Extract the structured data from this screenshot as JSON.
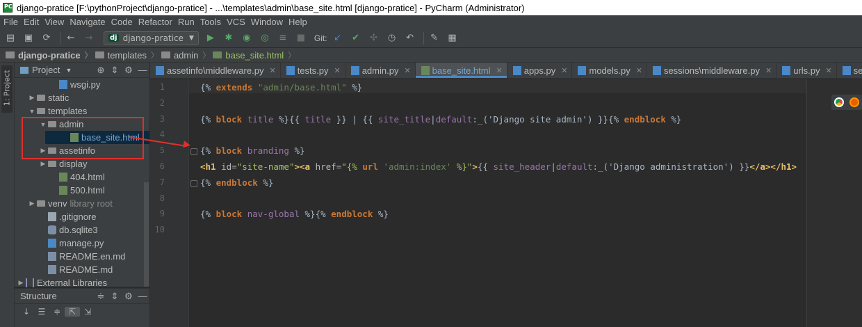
{
  "window": {
    "title": "django-pratice [F:\\pythonProject\\django-pratice] - ...\\templates\\admin\\base_site.html [django-pratice] - PyCharm (Administrator)"
  },
  "menu": [
    "File",
    "Edit",
    "View",
    "Navigate",
    "Code",
    "Refactor",
    "Run",
    "Tools",
    "VCS",
    "Window",
    "Help"
  ],
  "toolbar": {
    "run_config": "django-pratice",
    "run_config_badge": "dj",
    "git_label": "Git:"
  },
  "breadcrumbs": [
    "django-pratice",
    "templates",
    "admin",
    "base_site.html"
  ],
  "left_strip": {
    "project_tab": "1: Project"
  },
  "project_panel": {
    "title": "Project",
    "tree": [
      {
        "label": "wsgi.py",
        "kind": "py",
        "indent": 3,
        "arrow": ""
      },
      {
        "label": "static",
        "kind": "folder",
        "indent": 1,
        "arrow": "▶"
      },
      {
        "label": "templates",
        "kind": "folder",
        "indent": 1,
        "arrow": "▼"
      },
      {
        "label": "admin",
        "kind": "folder",
        "indent": 2,
        "arrow": "▼"
      },
      {
        "label": "base_site.html",
        "kind": "html",
        "indent": 4,
        "arrow": "",
        "selected": true
      },
      {
        "label": "assetinfo",
        "kind": "folder",
        "indent": 2,
        "arrow": "▶"
      },
      {
        "label": "display",
        "kind": "folder",
        "indent": 2,
        "arrow": "▶"
      },
      {
        "label": "404.html",
        "kind": "html",
        "indent": 3,
        "arrow": ""
      },
      {
        "label": "500.html",
        "kind": "html",
        "indent": 3,
        "arrow": ""
      },
      {
        "label": "venv",
        "kind": "folder",
        "indent": 1,
        "arrow": "▶",
        "sub": "library root"
      },
      {
        "label": ".gitignore",
        "kind": "file",
        "indent": 2,
        "arrow": ""
      },
      {
        "label": "db.sqlite3",
        "kind": "db",
        "indent": 2,
        "arrow": ""
      },
      {
        "label": "manage.py",
        "kind": "py",
        "indent": 2,
        "arrow": ""
      },
      {
        "label": "README.en.md",
        "kind": "md",
        "indent": 2,
        "arrow": ""
      },
      {
        "label": "README.md",
        "kind": "md",
        "indent": 2,
        "arrow": ""
      },
      {
        "label": "External Libraries",
        "kind": "lib",
        "indent": 0,
        "arrow": "▶"
      }
    ]
  },
  "structure_panel": {
    "title": "Structure"
  },
  "tabs": [
    {
      "label": "assetinfo\\middleware.py",
      "kind": "py"
    },
    {
      "label": "tests.py",
      "kind": "py"
    },
    {
      "label": "admin.py",
      "kind": "py"
    },
    {
      "label": "base_site.html",
      "kind": "html",
      "active": true
    },
    {
      "label": "apps.py",
      "kind": "py"
    },
    {
      "label": "models.py",
      "kind": "py"
    },
    {
      "label": "sessions\\middleware.py",
      "kind": "py"
    },
    {
      "label": "urls.py",
      "kind": "py"
    },
    {
      "label": "security.py",
      "kind": "py"
    }
  ],
  "editor": {
    "line_numbers": [
      "1",
      "2",
      "3",
      "4",
      "5",
      "6",
      "7",
      "8",
      "9",
      "10"
    ],
    "lines": [
      [
        {
          "t": "{% ",
          "c": "tk-pct"
        },
        {
          "t": "extends ",
          "c": "tk-kw"
        },
        {
          "t": "\"admin/base.html\"",
          "c": "tk-str"
        },
        {
          "t": " %}",
          "c": "tk-pct"
        }
      ],
      [],
      [
        {
          "t": "{% ",
          "c": "tk-pct"
        },
        {
          "t": "block ",
          "c": "tk-kw"
        },
        {
          "t": "title",
          "c": "tk-name"
        },
        {
          "t": " %}{{ ",
          "c": "tk-pct"
        },
        {
          "t": "title",
          "c": "tk-name"
        },
        {
          "t": " }} | {{ ",
          "c": "tk-pct"
        },
        {
          "t": "site_title",
          "c": "tk-name"
        },
        {
          "t": "|",
          "c": "tk-pct"
        },
        {
          "t": "default",
          "c": "tk-name"
        },
        {
          "t": ":_('Django site admin') }}{% ",
          "c": "tk-pct"
        },
        {
          "t": "endblock",
          "c": "tk-kw"
        },
        {
          "t": " %}",
          "c": "tk-pct"
        }
      ],
      [],
      [
        {
          "t": "{% ",
          "c": "tk-pct"
        },
        {
          "t": "block ",
          "c": "tk-kw"
        },
        {
          "t": "branding",
          "c": "tk-name"
        },
        {
          "t": " %}",
          "c": "tk-pct"
        }
      ],
      [
        {
          "t": "<h1 ",
          "c": "tk-tag"
        },
        {
          "t": "id=",
          "c": "tk-attr"
        },
        {
          "t": "\"site-name\"",
          "c": "tk-val"
        },
        {
          "t": "><a ",
          "c": "tk-tag"
        },
        {
          "t": "href=",
          "c": "tk-attr"
        },
        {
          "t": "\"{% ",
          "c": "tk-val"
        },
        {
          "t": "url ",
          "c": "tk-kw"
        },
        {
          "t": "'admin:index'",
          "c": "tk-str"
        },
        {
          "t": " %}\"",
          "c": "tk-val"
        },
        {
          "t": ">",
          "c": "tk-tag"
        },
        {
          "t": "{{ ",
          "c": "tk-pct"
        },
        {
          "t": "site_header",
          "c": "tk-name"
        },
        {
          "t": "|",
          "c": "tk-pct"
        },
        {
          "t": "default",
          "c": "tk-name"
        },
        {
          "t": ":_('Django administration') }}",
          "c": "tk-pct"
        },
        {
          "t": "</a></h1>",
          "c": "tk-tag"
        }
      ],
      [
        {
          "t": "{% ",
          "c": "tk-pct"
        },
        {
          "t": "endblock",
          "c": "tk-kw"
        },
        {
          "t": " %}",
          "c": "tk-pct"
        }
      ],
      [],
      [
        {
          "t": "{% ",
          "c": "tk-pct"
        },
        {
          "t": "block ",
          "c": "tk-kw"
        },
        {
          "t": "nav-global",
          "c": "tk-name"
        },
        {
          "t": " %}{% ",
          "c": "tk-pct"
        },
        {
          "t": "endblock",
          "c": "tk-kw"
        },
        {
          "t": " %}",
          "c": "tk-pct"
        }
      ],
      []
    ]
  },
  "colors": {
    "accent_blue": "#4a88c7",
    "annotation_red": "#e0302a",
    "editor_bg": "#2b2b2b",
    "panel_bg": "#3c3f41"
  }
}
